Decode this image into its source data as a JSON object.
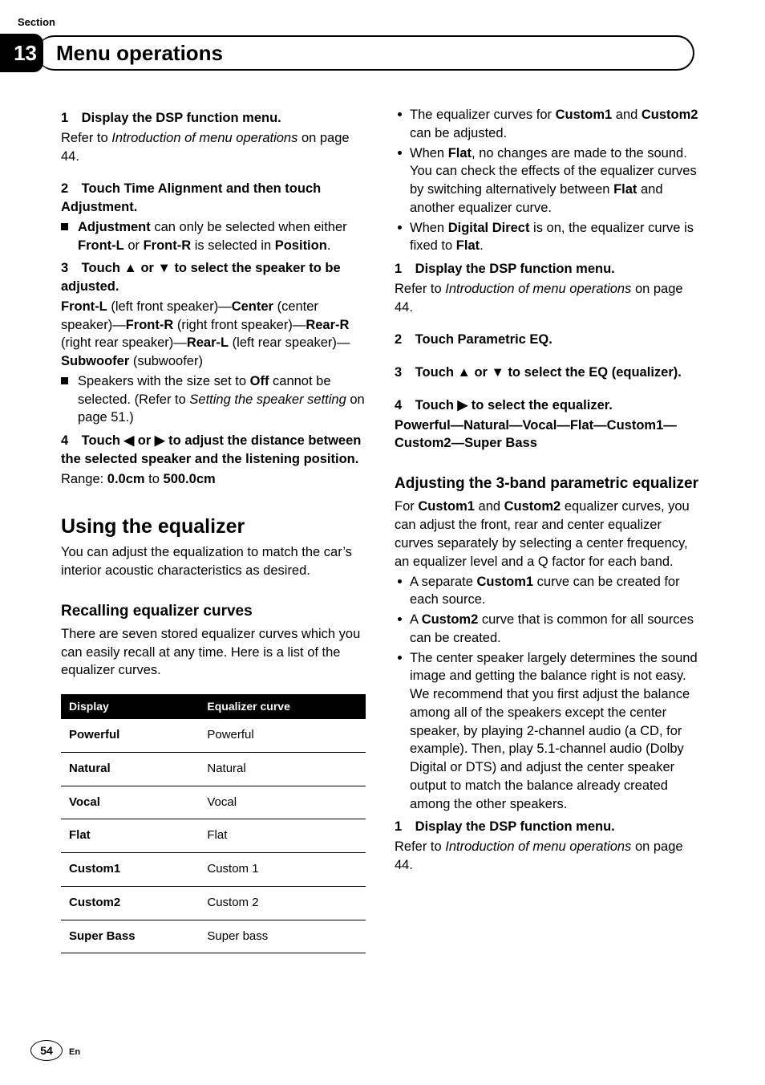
{
  "section_label": "Section",
  "section_number": "13",
  "section_title": "Menu operations",
  "left": {
    "step1_head": "1 Display the DSP function menu.",
    "step1_body_a": "Refer to ",
    "step1_body_i": "Introduction of menu operations",
    "step1_body_b": " on page 44.",
    "step2_head": "2 Touch Time Alignment and then touch Adjustment.",
    "note1_a": "Adjustment",
    "note1_b": " can only be selected when either ",
    "note1_c": "Front-L",
    "note1_d": " or ",
    "note1_e": "Front-R",
    "note1_f": " is selected in ",
    "note1_g": "Position",
    "note1_h": ".",
    "step3_head": "3 Touch ▲ or ▼ to select the speaker to be adjusted.",
    "speakers_a": "Front-L",
    "speakers_b": " (left front speaker)—",
    "speakers_c": "Center",
    "speakers_d": " (center speaker)—",
    "speakers_e": "Front-R",
    "speakers_f": " (right front speaker)—",
    "speakers_g": "Rear-R",
    "speakers_h": " (right rear speaker)—",
    "speakers_i": "Rear-L",
    "speakers_j": " (left rear speaker)—",
    "speakers_k": "Subwoofer",
    "speakers_l": " (subwoofer)",
    "note2_a": "Speakers with the size set to ",
    "note2_b": "Off",
    "note2_c": " cannot be selected. (Refer to ",
    "note2_d": "Setting the speaker setting",
    "note2_e": " on page 51.)",
    "step4_head": "4 Touch ◀ or ▶ to adjust the distance between the selected speaker and the listening position.",
    "step4_body_a": "Range: ",
    "step4_body_b": "0.0cm",
    "step4_body_c": " to ",
    "step4_body_d": "500.0cm",
    "h2": "Using the equalizer",
    "h2_desc": "You can adjust the equalization to match the car’s interior acoustic characteristics as desired.",
    "h3": "Recalling equalizer curves",
    "h3_desc": "There are seven stored equalizer curves which you can easily recall at any time. Here is a list of the equalizer curves.",
    "table": {
      "head_display": "Display",
      "head_curve": "Equalizer curve",
      "rows": [
        {
          "d": "Powerful",
          "c": "Powerful"
        },
        {
          "d": "Natural",
          "c": "Natural"
        },
        {
          "d": "Vocal",
          "c": "Vocal"
        },
        {
          "d": "Flat",
          "c": "Flat"
        },
        {
          "d": "Custom1",
          "c": "Custom 1"
        },
        {
          "d": "Custom2",
          "c": "Custom 2"
        },
        {
          "d": "Super Bass",
          "c": "Super bass"
        }
      ]
    }
  },
  "right": {
    "b1_a": "The equalizer curves for ",
    "b1_b": "Custom1",
    "b1_c": " and ",
    "b1_d": "Custom2",
    "b1_e": " can be adjusted.",
    "b2_a": "When ",
    "b2_b": "Flat",
    "b2_c": ", no changes are made to the sound. You can check the effects of the equalizer curves by switching alternatively between ",
    "b2_d": "Flat",
    "b2_e": " and another equalizer curve.",
    "b3_a": "When ",
    "b3_b": "Digital Direct",
    "b3_c": " is on, the equalizer curve is fixed to ",
    "b3_d": "Flat",
    "b3_e": ".",
    "step1_head": "1 Display the DSP function menu.",
    "step1_body_a": "Refer to ",
    "step1_body_i": "Introduction of menu operations",
    "step1_body_b": " on page 44.",
    "step2_head": "2 Touch Parametric EQ.",
    "step3_head": "3 Touch ▲ or ▼ to select the EQ (equalizer).",
    "step4_head": "4 Touch ▶ to select the equalizer.",
    "step4_list": "Powerful—Natural—Vocal—Flat—Custom1—Custom2—Super Bass",
    "h3": "Adjusting the 3-band parametric equalizer",
    "h3_desc_a": "For ",
    "h3_desc_b": "Custom1",
    "h3_desc_c": " and ",
    "h3_desc_d": "Custom2",
    "h3_desc_e": " equalizer curves, you can adjust the front, rear and center equalizer curves separately by selecting a center frequency, an equalizer level and a Q factor for each band.",
    "bb1_a": "A separate ",
    "bb1_b": "Custom1",
    "bb1_c": " curve can be created for each source.",
    "bb2_a": "A ",
    "bb2_b": "Custom2",
    "bb2_c": " curve that is common for all sources can be created.",
    "bb3": "The center speaker largely determines the sound image and getting the balance right is not easy. We recommend that you first adjust the balance among all of the speakers except the center speaker, by playing 2-channel audio (a CD, for example). Then, play 5.1-channel audio (Dolby Digital or DTS) and adjust the center speaker output to match the balance already created among the other speakers.",
    "stepB1_head": "1 Display the DSP function menu.",
    "stepB1_body_a": "Refer to ",
    "stepB1_body_i": "Introduction of menu operations",
    "stepB1_body_b": " on page 44."
  },
  "page_number": "54",
  "lang": "En"
}
